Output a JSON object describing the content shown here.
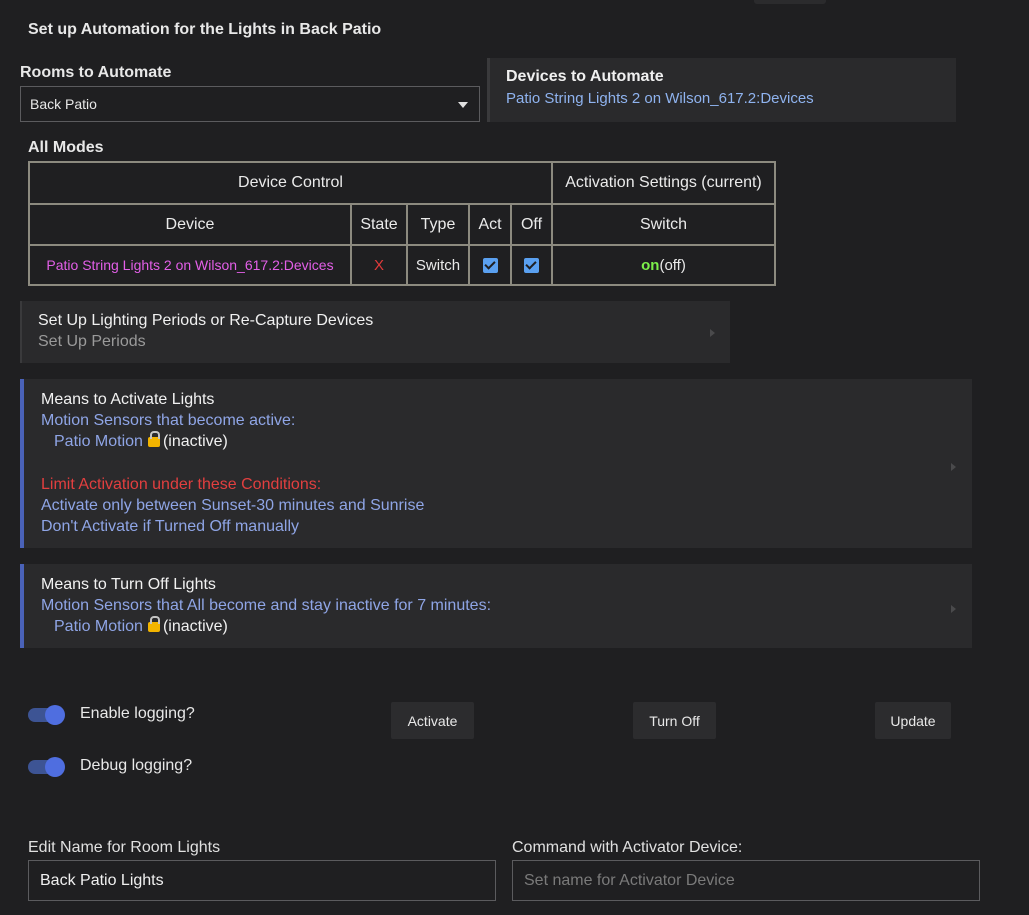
{
  "page_title": "Set up Automation for the Lights in Back Patio",
  "rooms": {
    "label": "Rooms to Automate",
    "selected": "Back Patio"
  },
  "devices": {
    "label": "Devices to Automate",
    "value": "Patio String Lights 2 on Wilson_617.2:Devices"
  },
  "modes_table": {
    "caption": "All Modes",
    "group_headers": {
      "device_control": "Device Control",
      "activation": "Activation Settings (current)"
    },
    "columns": {
      "device": "Device",
      "state": "State",
      "type": "Type",
      "act": "Act",
      "off": "Off",
      "switch": "Switch"
    },
    "rows": [
      {
        "device": "Patio String Lights 2 on Wilson_617.2:Devices",
        "state": "X",
        "type": "Switch",
        "act_checked": true,
        "off_checked": true,
        "switch_on": "on",
        "switch_current": "(off)"
      }
    ]
  },
  "setup_periods": {
    "title": "Set Up Lighting Periods or Re-Capture Devices",
    "subtitle": "Set Up Periods"
  },
  "activate_panel": {
    "title": "Means to Activate Lights",
    "sensors_line": "Motion Sensors that become active:",
    "sensor_name": "Patio Motion",
    "sensor_state": "(inactive)",
    "limit_heading": "Limit Activation under these Conditions:",
    "condition_1": "Activate only between Sunset-30 minutes and Sunrise",
    "condition_2": "Don't Activate if Turned Off manually"
  },
  "turnoff_panel": {
    "title": "Means to Turn Off Lights",
    "sensors_line": "Motion Sensors that All become and stay inactive for 7 minutes:",
    "sensor_name": "Patio Motion",
    "sensor_state": "(inactive)"
  },
  "toggles": {
    "enable_logging": "Enable logging?",
    "debug_logging": "Debug logging?",
    "enable_on": true,
    "debug_on": true
  },
  "buttons": {
    "activate": "Activate",
    "turn_off": "Turn Off",
    "update": "Update"
  },
  "name_field": {
    "label": "Edit Name for Room Lights",
    "value": "Back Patio Lights"
  },
  "activator_field": {
    "label": "Command with Activator Device:",
    "placeholder": "Set name for Activator Device"
  },
  "colors": {
    "accent": "#4f6ee0",
    "link": "#8fa5e6",
    "device_link": "#e35fe8",
    "error": "#e03a3a",
    "on": "#7cf04a"
  },
  "icons": {
    "select_caret": "caret-down-icon",
    "panel_chevron": "chevron-right-icon",
    "lock": "lock-icon",
    "checkbox": "checkbox-checked-icon"
  }
}
